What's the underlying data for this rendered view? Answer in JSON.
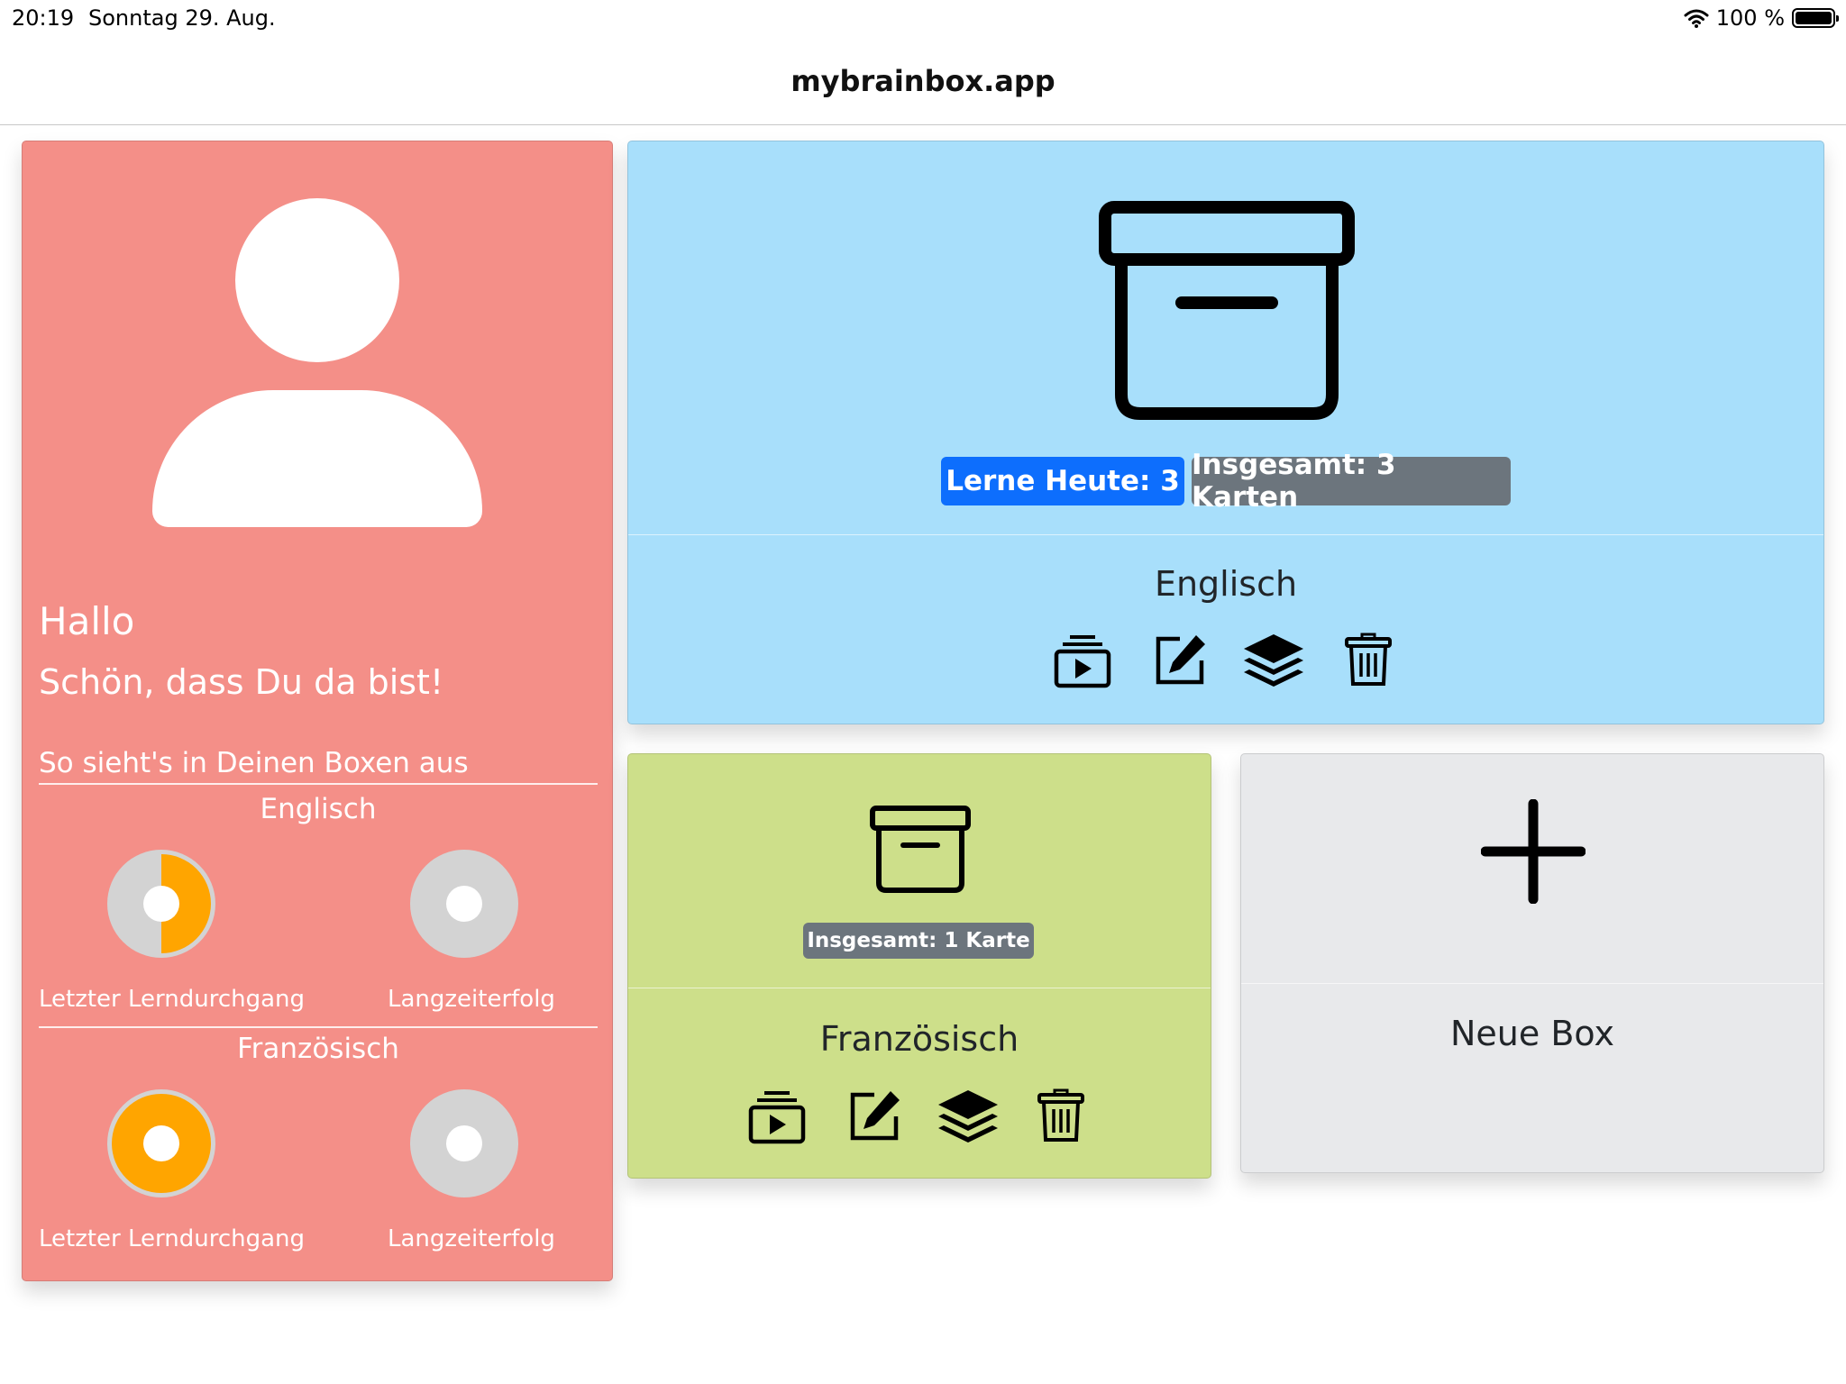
{
  "status_bar": {
    "time": "20:19",
    "date": "Sonntag 29. Aug.",
    "battery": "100 %"
  },
  "browser": {
    "url": "mybrainbox.app"
  },
  "profile": {
    "greeting": "Hallo",
    "welcome": "Schön, dass Du da bist!",
    "boxes_heading": "So sieht's in Deinen Boxen aus",
    "sections": [
      {
        "title": "Englisch",
        "last_run_label": "Letzter Lerndurchgang",
        "long_term_label": "Langzeiterfolg",
        "last_run_fraction": 0.5,
        "long_term_fraction": 0
      },
      {
        "title": "Französisch",
        "last_run_label": "Letzter Lerndurchgang",
        "long_term_label": "Langzeiterfolg",
        "last_run_fraction": 1.0,
        "long_term_fraction": 0
      }
    ],
    "colors": {
      "card": "#f48f88",
      "progress": "#ffa500",
      "track": "#d3d3d3"
    }
  },
  "boxes": [
    {
      "name": "Englisch",
      "learn_today": "Lerne Heute: 3",
      "total": "Insgesamt: 3 Karten",
      "color": "#a8dffb"
    },
    {
      "name": "Französisch",
      "total": "Insgesamt: 1 Karte",
      "color": "#cddf8a"
    }
  ],
  "new_box": {
    "label": "Neue Box",
    "color": "#e8e9eb"
  },
  "badge_colors": {
    "primary": "#0d6efd",
    "secondary": "#6c757d"
  },
  "icons": [
    "wifi-icon",
    "battery-icon",
    "user-avatar-icon",
    "archive-box-icon",
    "play-cards-icon",
    "edit-icon",
    "layers-icon",
    "trash-icon",
    "plus-icon"
  ]
}
